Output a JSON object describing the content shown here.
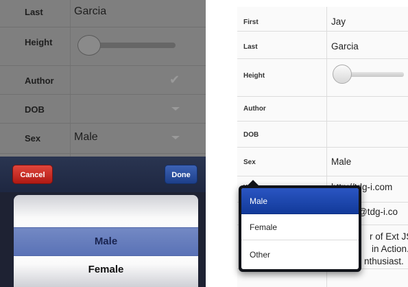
{
  "phone": {
    "form": {
      "last_label": "Last",
      "last_value": "Garcia",
      "height_label": "Height",
      "author_label": "Author",
      "dob_label": "DOB",
      "sex_label": "Sex",
      "sex_value": "Male"
    },
    "toolbar": {
      "cancel_label": "Cancel",
      "done_label": "Done"
    },
    "picker": {
      "options": [
        "Male",
        "Female"
      ],
      "selected": "Male"
    }
  },
  "tablet": {
    "form": {
      "first_label": "First",
      "first_value": "Jay",
      "last_label": "Last",
      "last_value": "Garcia",
      "height_label": "Height",
      "author_label": "Author",
      "dob_label": "DOB",
      "sex_label": "Sex",
      "sex_value": "Male",
      "website_label": "W",
      "website_value": "http://tdg-i.com",
      "email_value": "@tdg-i.co",
      "bio_line1": "r of Ext JS",
      "bio_line2": "in Action.",
      "bio_line3": "nthusiast."
    },
    "popover": {
      "options": [
        "Male",
        "Female",
        "Other"
      ],
      "selected": "Male"
    }
  },
  "colors": {
    "cancel": "#c62a22",
    "done": "#2a4f9f",
    "selection": "#1e48b0",
    "toolbar": "#242e49"
  }
}
